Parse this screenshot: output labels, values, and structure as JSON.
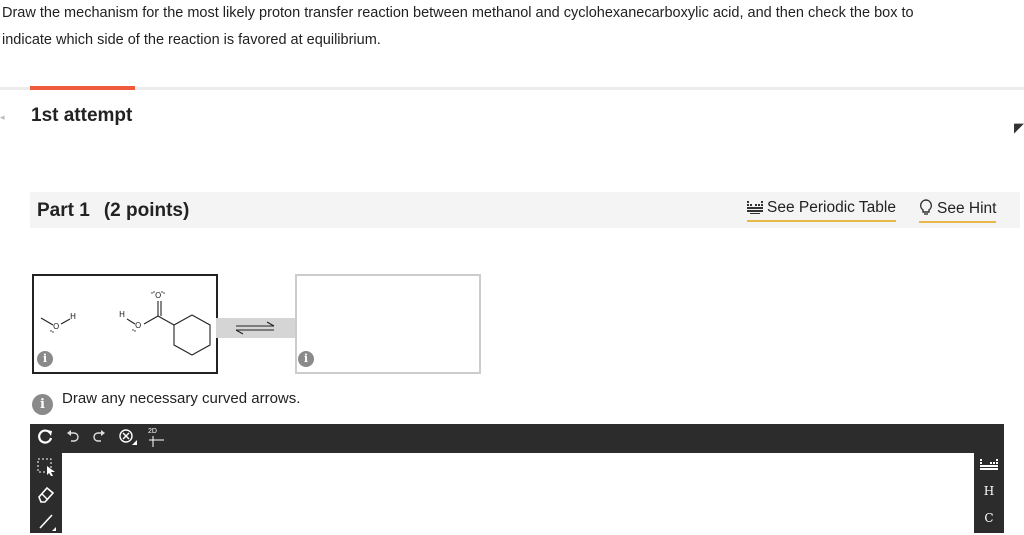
{
  "question": {
    "line1": "Draw the mechanism for the most likely proton transfer reaction between methanol and cyclohexanecarboxylic acid, and then check the box to",
    "line2": "indicate which side of the reaction is favored at equilibrium."
  },
  "attempt": {
    "label": "1st attempt"
  },
  "part": {
    "title": "Part 1",
    "points": "(2 points)",
    "periodic_link": "See Periodic Table",
    "hint_link": "See Hint"
  },
  "reaction": {
    "methanol_o": "O",
    "methanol_h": "H",
    "acid_h": "H",
    "acid_o_single": "O",
    "acid_o_double": "O"
  },
  "instruction": {
    "text": "Draw any necessary curved arrows."
  },
  "toolbar": {
    "icons": [
      "reset-icon",
      "undo-icon",
      "redo-icon",
      "clear-icon",
      "2d-clean-icon"
    ],
    "label_2d": "2D"
  },
  "side_right": {
    "elements": [
      "H",
      "C"
    ]
  },
  "colors": {
    "accent": "#ef5a3c",
    "link_underline": "#e8b74a",
    "toolbar": "#2c2c2c"
  }
}
